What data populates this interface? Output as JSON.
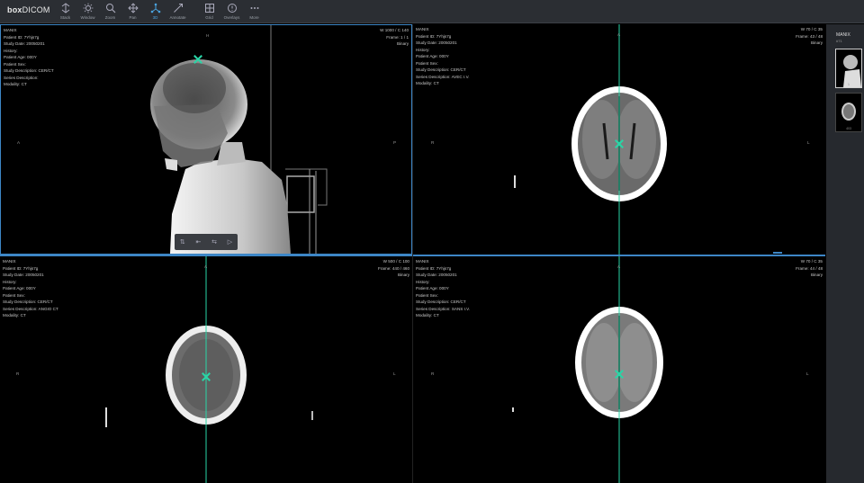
{
  "app": {
    "brand_bold": "box",
    "brand_rest": "DICOM"
  },
  "toolbar": {
    "tools": [
      {
        "label": "Stack",
        "icon": "stack-icon"
      },
      {
        "label": "Window",
        "icon": "window-icon"
      },
      {
        "label": "Zoom",
        "icon": "zoom-icon"
      },
      {
        "label": "Pan",
        "icon": "pan-icon"
      },
      {
        "label": "3D",
        "icon": "3d-icon",
        "active": true
      },
      {
        "label": "Annotate",
        "icon": "annotate-icon"
      },
      {
        "label": "Grid",
        "icon": "grid-icon"
      },
      {
        "label": "Overlays",
        "icon": "overlays-icon"
      },
      {
        "label": "More",
        "icon": "more-icon"
      }
    ]
  },
  "viewports": [
    {
      "lines": [
        "MANIX",
        "Patient ID: 7Yhjs7g",
        "Study Date: 20050201",
        "History:",
        "Patient Age: 000Y",
        "Patient Sex:",
        "Study Description: CER/CT",
        "Series Description:",
        "Modality: CT"
      ],
      "wl": "W 1000 / C 140",
      "frame": "Frame: 1 / 1",
      "mode": "Binary",
      "orient": {
        "top": "H",
        "left": "A",
        "right": "P"
      }
    },
    {
      "lines": [
        "MANIX",
        "Patient ID: 7Yhjs7g",
        "Study Date: 20050201",
        "History:",
        "Patient Age: 000Y",
        "Patient Sex:",
        "Study Description: CER/CT",
        "Series Description: AVEC I.V.",
        "Modality: CT"
      ],
      "wl": "W 70 / C 35",
      "frame": "Frame: 43 / 48",
      "mode": "Binary",
      "orient": {
        "top": "A",
        "left": "R",
        "right": "L"
      }
    },
    {
      "lines": [
        "MANIX",
        "Patient ID: 7Yhjs7g",
        "Study Date: 20050201",
        "History:",
        "Patient Age: 000Y",
        "Patient Sex:",
        "Study Description: CER/CT",
        "Series Description: ANGIO CT",
        "Modality: CT"
      ],
      "wl": "W 500 / C 100",
      "frame": "Frame: 440 / 460",
      "mode": "Binary",
      "orient": {
        "top": "A",
        "left": "R",
        "right": "L"
      }
    },
    {
      "lines": [
        "MANIX",
        "Patient ID: 7Yhjs7g",
        "Study Date: 20050201",
        "History:",
        "Patient Age: 000Y",
        "Patient Sex:",
        "Study Description: CER/CT",
        "Series Description: SANS I.V.",
        "Modality: CT"
      ],
      "wl": "W 70 / C 35",
      "frame": "Frame: 44 / 48",
      "mode": "Binary",
      "orient": {
        "top": "A",
        "left": "R",
        "right": "L"
      }
    }
  ],
  "side": {
    "title": "MANIX",
    "subtitle": "#71",
    "thumbs": [
      "1",
      "403"
    ]
  },
  "colors": {
    "accent": "#3d86c6",
    "crosshair": "#29d6a7",
    "toolbar_bg": "#2b2e33"
  }
}
